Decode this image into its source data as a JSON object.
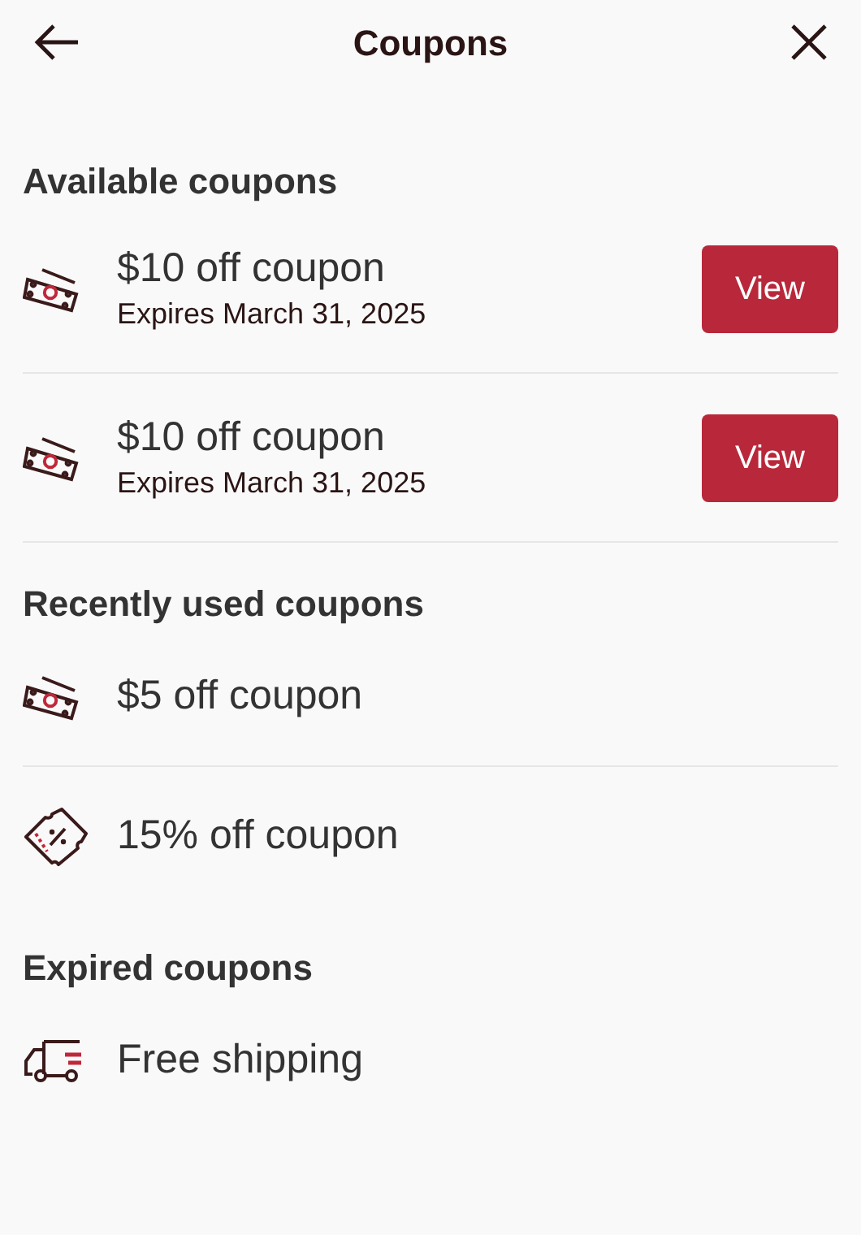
{
  "header": {
    "title": "Coupons"
  },
  "sections": [
    {
      "title": "Available coupons",
      "items": [
        {
          "kind": "cash",
          "title": "$10 off coupon",
          "subtitle": "Expires March 31, 2025",
          "button": "View",
          "divider_below": true
        },
        {
          "kind": "cash",
          "title": "$10 off coupon",
          "subtitle": "Expires March 31, 2025",
          "button": "View",
          "divider_below": true
        }
      ]
    },
    {
      "title": "Recently used coupons",
      "items": [
        {
          "kind": "cash",
          "title": "$5 off coupon",
          "divider_below": true
        },
        {
          "kind": "ticket",
          "title": "15% off coupon",
          "divider_below": false
        }
      ]
    },
    {
      "title": "Expired coupons",
      "items": [
        {
          "kind": "truck",
          "title": "Free shipping",
          "divider_below": false
        }
      ]
    }
  ]
}
